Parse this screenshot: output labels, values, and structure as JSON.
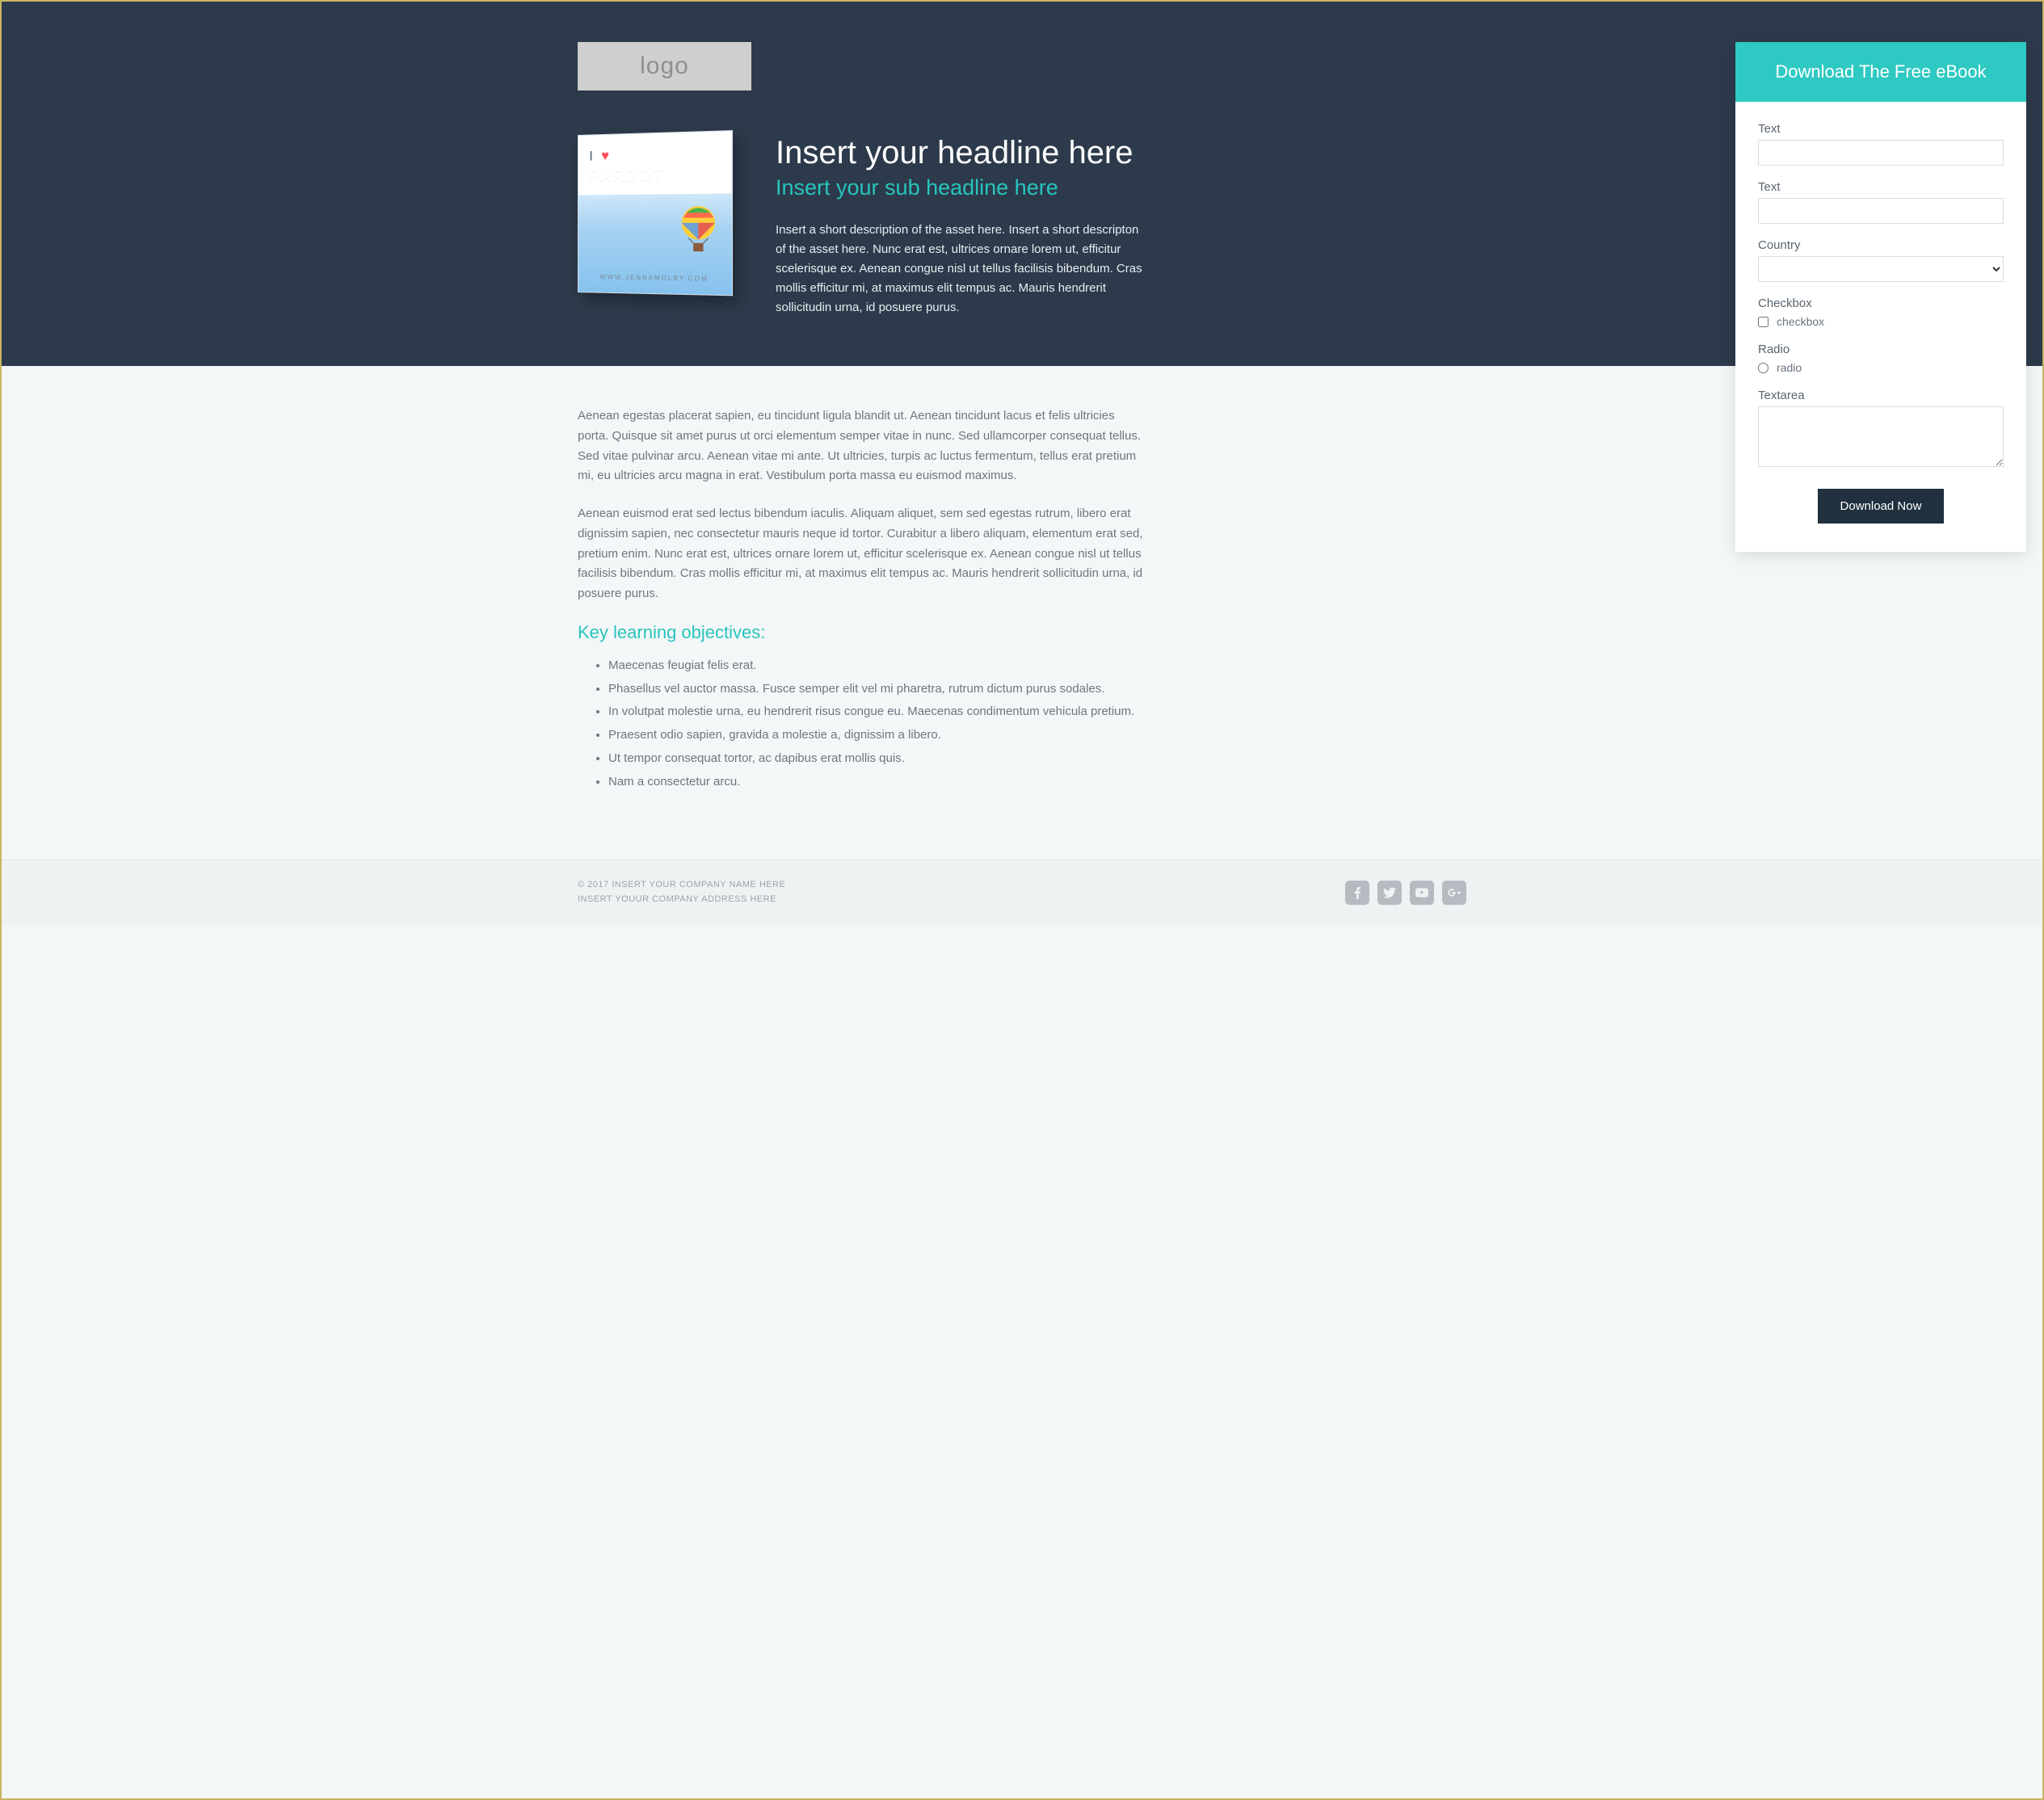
{
  "logo_text": "logo",
  "book": {
    "line1": "I",
    "line2": "PARDOT",
    "url": "WWW.JENNAMOLBY.COM"
  },
  "hero": {
    "headline": "Insert your headline here",
    "subheadline": "Insert your sub headline here",
    "description": "Insert a short description of the asset here. Insert a short descripton of the asset here. Nunc erat est, ultrices ornare lorem ut, efficitur scelerisque ex. Aenean congue nisl ut tellus facilisis bibendum. Cras mollis efficitur mi, at maximus elit tempus ac. Mauris hendrerit sollicitudin urna, id posuere purus."
  },
  "form": {
    "title": "Download The Free eBook",
    "fields": {
      "text1_label": "Text",
      "text2_label": "Text",
      "country_label": "Country",
      "checkbox_section_label": "Checkbox",
      "checkbox_option": "checkbox",
      "radio_section_label": "Radio",
      "radio_option": "radio",
      "textarea_label": "Textarea"
    },
    "submit_label": "Download Now"
  },
  "body": {
    "para1": "Aenean egestas placerat sapien, eu tincidunt ligula blandit ut. Aenean tincidunt lacus et felis ultricies porta. Quisque sit amet purus ut orci elementum semper vitae in nunc. Sed ullamcorper consequat tellus. Sed vitae pulvinar arcu. Aenean vitae mi ante. Ut ultricies, turpis ac luctus fermentum, tellus erat pretium mi, eu ultricies arcu magna in erat. Vestibulum porta massa eu euismod maximus.",
    "para2": "Aenean euismod erat sed lectus bibendum iaculis. Aliquam aliquet, sem sed egestas rutrum, libero erat dignissim sapien, nec consectetur mauris neque id tortor. Curabitur a libero aliquam, elementum erat sed, pretium enim. Nunc erat est, ultrices ornare lorem ut, efficitur scelerisque ex. Aenean congue nisl ut tellus facilisis bibendum. Cras mollis efficitur mi, at maximus elit tempus ac. Mauris hendrerit sollicitudin urna, id posuere purus.",
    "objectives_title": "Key learning objectives:",
    "objectives": [
      "Maecenas feugiat felis erat.",
      "Phasellus vel auctor massa. Fusce semper elit vel mi pharetra, rutrum dictum purus sodales.",
      "In volutpat molestie urna, eu hendrerit risus congue eu. Maecenas condimentum vehicula pretium.",
      "Praesent odio sapien, gravida a molestie a, dignissim a libero.",
      "Ut tempor consequat tortor, ac dapibus erat mollis quis.",
      "Nam a consectetur arcu."
    ]
  },
  "footer": {
    "line1": "© 2017 INSERT YOUR COMPANY NAME HERE",
    "line2": "INSERT YOUUR COMPANY ADDRESS HERE"
  }
}
